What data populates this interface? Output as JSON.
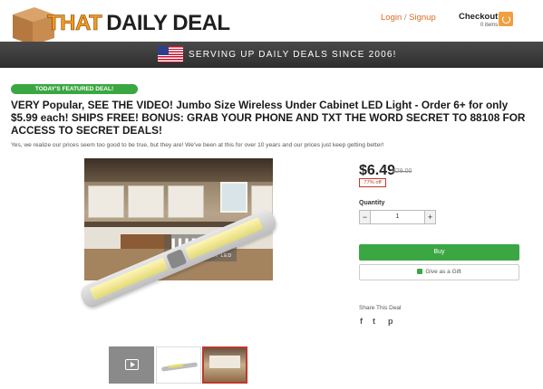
{
  "header": {
    "logo_that": "THAT",
    "logo_deal": "DAILY DEAL",
    "login": "Login",
    "signup": "Signup",
    "checkout": "Checkout",
    "items": "0 items"
  },
  "banner": {
    "tagline": "SERVING UP DAILY DEALS SINCE 2006!"
  },
  "deal": {
    "featured_badge": "TODAY'S FEATURED DEAL!",
    "title": "VERY Popular, SEE THE VIDEO! Jumbo Size Wireless Under Cabinet LED Light - Order 6+ for only $5.99 each! SHIPS FREE! BONUS: GRAB YOUR PHONE AND TXT THE WORD SECRET TO 88108 FOR ACCESS TO SECRET DEALS!",
    "subtitle": "Yes, we realize our prices seem too good to be true, but they are! We've been at this for over 10 years and our prices just keep getting better!",
    "image_title": "JUMBO",
    "image_subtitle": "UNDER CABINET LED"
  },
  "pricing": {
    "price": "$6.49",
    "old_price": "$28.00",
    "discount": "77% off"
  },
  "purchase": {
    "quantity_label": "Quantity",
    "quantity_value": "1",
    "minus": "−",
    "plus": "+",
    "buy_label": "Buy",
    "gift_label": "Give as a Gift"
  },
  "share": {
    "label": "Share This Deal",
    "icons": [
      "facebook-icon",
      "twitter-icon",
      "pinterest-icon"
    ],
    "facebook": "f",
    "twitter": "t",
    "pinterest": "p"
  },
  "colors": {
    "brand_orange": "#f29a1f",
    "link_orange": "#e06a1f",
    "green": "#3aa742",
    "discount_red": "#c0392b",
    "banner_dark": "#3a3a3a"
  }
}
